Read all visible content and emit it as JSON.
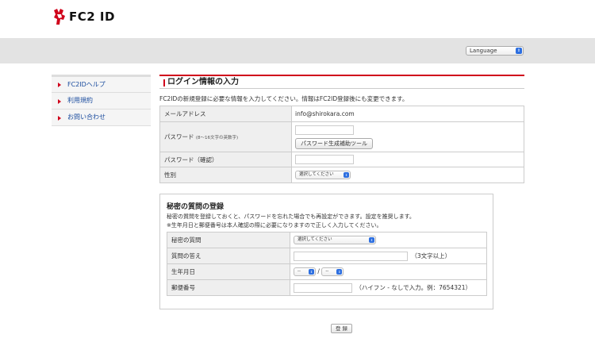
{
  "header": {
    "logo_text": "FC2 ID"
  },
  "language": {
    "label": "Language"
  },
  "sidebar": {
    "items": [
      {
        "label": "FC2IDヘルプ"
      },
      {
        "label": "利用規約"
      },
      {
        "label": "お問い合わせ"
      }
    ]
  },
  "login_section": {
    "title": "ログイン情報の入力",
    "intro": "FC2IDの新規登録に必要な情報を入力してください。情報はFC2ID登録後にも変更できます。",
    "fields": {
      "email_label": "メールアドレス",
      "email_value": "info@shirokara.com",
      "password_label": "パスワード",
      "password_note": "(8～16文字の英数字)",
      "password_tool_button": "パスワード生成補助ツール",
      "password_confirm_label": "パスワード（確認）",
      "gender_label": "性別",
      "gender_select": "選択してください"
    }
  },
  "secret_section": {
    "title": "秘密の質問の登録",
    "desc1": "秘密の質問を登録しておくと、パスワードを忘れた場合でも再設定ができます。設定を推奨します。",
    "desc2": "※生年月日と郵便番号は本人確認の際に必要になりますので正しく入力してください。",
    "fields": {
      "question_label": "秘密の質問",
      "question_select": "選択してください",
      "answer_label": "質問の答え",
      "answer_hint": "（3文字以上）",
      "birth_label": "生年月日",
      "birth_month": "--",
      "birth_sep": "/",
      "birth_day": "--",
      "zip_label": "郵便番号",
      "zip_hint": "（ハイフン - なしで入力。例：7654321）"
    }
  },
  "submit_button": "登 録",
  "colors": {
    "accent": "#d0021b",
    "link": "#1a4c9e",
    "select_arrow": "#2d6fe0"
  }
}
